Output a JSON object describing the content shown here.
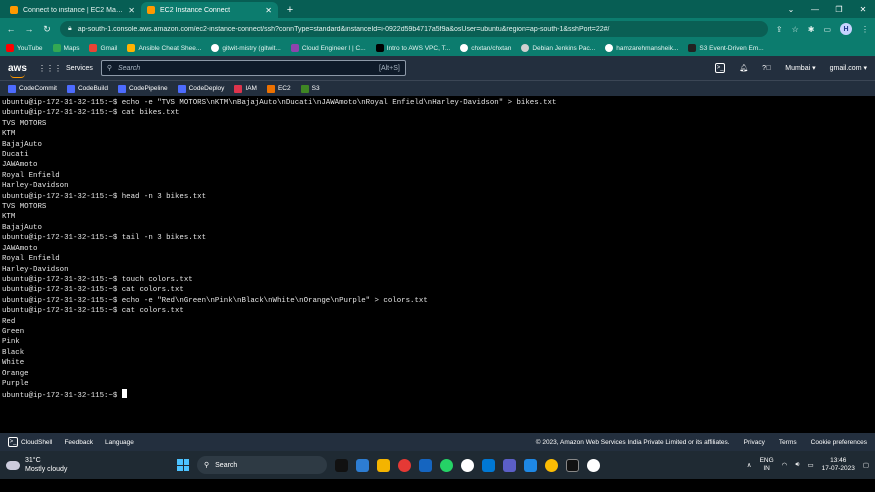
{
  "browser": {
    "tabs": [
      {
        "title": "Connect to instance | EC2 Manag",
        "active": false
      },
      {
        "title": "EC2 Instance Connect",
        "active": true
      }
    ],
    "url": "ap-south-1.console.aws.amazon.com/ec2-instance-connect/ssh?connType=standard&instanceId=i-0922d59b4717a5f9a&osUser=ubuntu&region=ap-south-1&sshPort=22#/",
    "profile_initial": "H",
    "bookmarks": [
      "YouTube",
      "Maps",
      "Gmail",
      "Ansible Cheat Shee...",
      "gitwit-mistry (gitwit...",
      "Cloud Engineer I | C...",
      "Intro to AWS VPC, T...",
      "chxtan/chxtan",
      "Debian Jenkins Pac...",
      "hamzarehmansheik...",
      "S3 Event-Driven Em..."
    ]
  },
  "aws": {
    "logo": "aws",
    "services_label": "Services",
    "search_placeholder": "Search",
    "search_shortcut": "[Alt+S]",
    "region": "Mumbai",
    "account": "gmail.com",
    "favorites": [
      "CodeCommit",
      "CodeBuild",
      "CodePipeline",
      "CodeDeploy",
      "IAM",
      "EC2",
      "S3"
    ]
  },
  "terminal": {
    "lines": [
      "ubuntu@ip-172-31-32-115:~$ echo -e \"TVS MOTORS\\nKTM\\nBajajAuto\\nDucati\\nJAWAmoto\\nRoyal Enfield\\nHarley-Davidson\" > bikes.txt",
      "ubuntu@ip-172-31-32-115:~$ cat bikes.txt",
      "TVS MOTORS",
      "KTM",
      "BajajAuto",
      "Ducati",
      "JAWAmoto",
      "Royal Enfield",
      "Harley-Davidson",
      "ubuntu@ip-172-31-32-115:~$ head -n 3 bikes.txt",
      "TVS MOTORS",
      "KTM",
      "BajajAuto",
      "ubuntu@ip-172-31-32-115:~$ tail -n 3 bikes.txt",
      "JAWAmoto",
      "Royal Enfield",
      "Harley-Davidson",
      "ubuntu@ip-172-31-32-115:~$ touch colors.txt",
      "ubuntu@ip-172-31-32-115:~$ cat colors.txt",
      "ubuntu@ip-172-31-32-115:~$ echo -e \"Red\\nGreen\\nPink\\nBlack\\nWhite\\nOrange\\nPurple\" > colors.txt",
      "ubuntu@ip-172-31-32-115:~$ cat colors.txt",
      "Red",
      "Green",
      "Pink",
      "Black",
      "White",
      "Orange",
      "Purple"
    ],
    "prompt": "ubuntu@ip-172-31-32-115:~$ "
  },
  "footer": {
    "cloudshell": "CloudShell",
    "feedback": "Feedback",
    "language": "Language",
    "copyright": "© 2023, Amazon Web Services India Private Limited or its affiliates.",
    "privacy": "Privacy",
    "terms": "Terms",
    "cookie": "Cookie preferences"
  },
  "taskbar": {
    "temp": "31°C",
    "weather": "Mostly cloudy",
    "search": "Search",
    "lang_line1": "ENG",
    "lang_line2": "IN",
    "time": "13:46",
    "date": "17-07-2023"
  },
  "colors": {
    "chrome_dark": "#075e54",
    "chrome": "#0c7c6e",
    "aws_navy": "#232f3e",
    "aws_orange": "#ff9900"
  }
}
